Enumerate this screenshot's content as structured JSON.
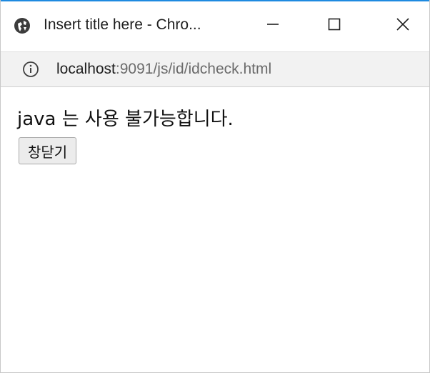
{
  "window": {
    "title": "Insert title here - Chro...",
    "accent_color": "#1e8ae0"
  },
  "address_bar": {
    "host": "localhost",
    "path": ":9091/js/id/idcheck.html",
    "icon": "info-icon"
  },
  "content": {
    "message": "java 는 사용 불가능합니다.",
    "close_button_label": "창닫기"
  },
  "icons": {
    "title": "globe-icon",
    "minimize": "minimize-icon",
    "maximize": "maximize-icon",
    "close": "close-icon"
  }
}
